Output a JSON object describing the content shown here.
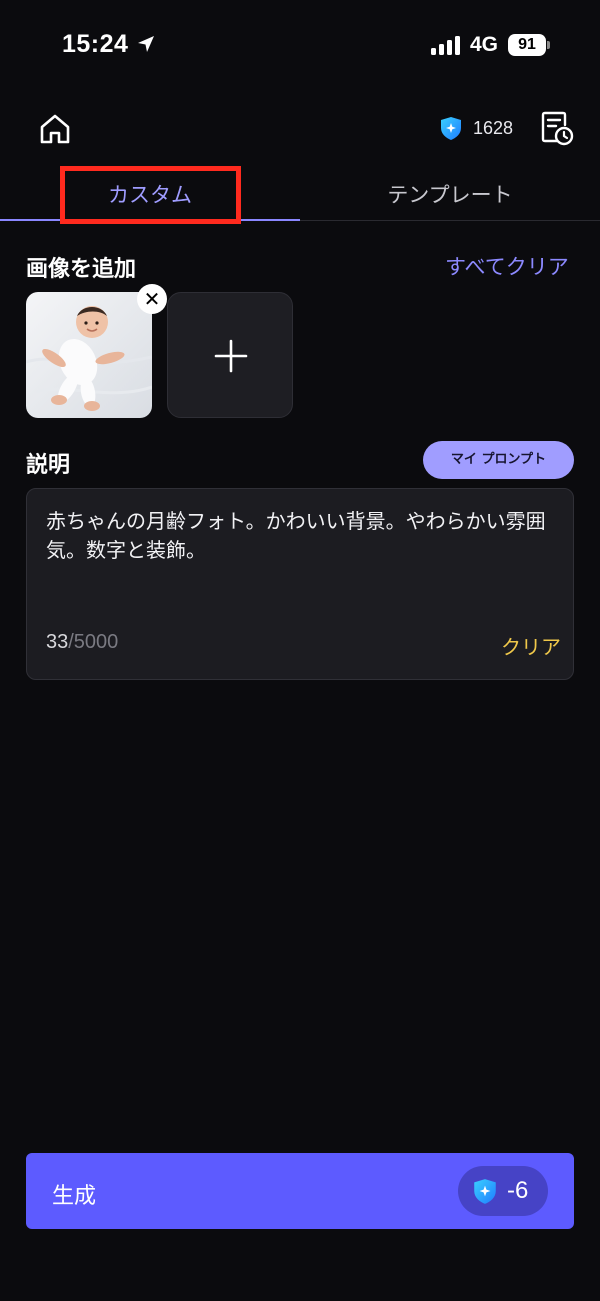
{
  "status": {
    "time": "15:24",
    "network": "4G",
    "battery": "91"
  },
  "header": {
    "credits": "1628"
  },
  "tabs": [
    {
      "label": "カスタム"
    },
    {
      "label": "テンプレート"
    }
  ],
  "images": {
    "title": "画像を追加",
    "clear_all": "すべてクリア"
  },
  "description": {
    "title": "説明",
    "my_prompt": "マイ プロンプト",
    "text": "赤ちゃんの月齢フォト。かわいい背景。やわらかい雰囲気。数字と装飾。",
    "count": "33",
    "max": "/5000",
    "clear": "クリア"
  },
  "generate": {
    "label": "生成",
    "cost": "-6"
  },
  "colors": {
    "accent": "#5d5bff",
    "tab_active": "#9f9cff",
    "clear": "#f0c84a",
    "highlight": "#ff2a1e"
  }
}
